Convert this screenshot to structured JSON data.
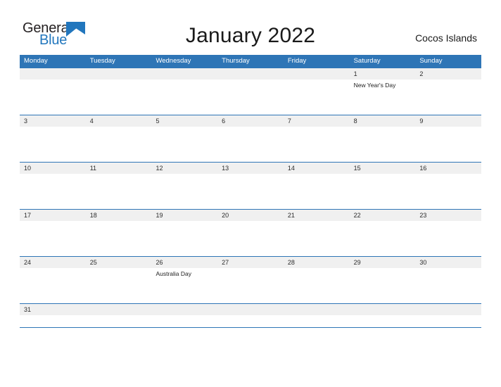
{
  "brand": {
    "name_part1": "General",
    "name_part2": "Blue",
    "flag_icon": "blue-flag-triangle",
    "accent_color": "#2176bd"
  },
  "header": {
    "title": "January 2022",
    "region": "Cocos Islands"
  },
  "theme": {
    "header_blue": "#2e75b6",
    "date_band_gray": "#f0f0f0",
    "text_dark": "#1a1a1a"
  },
  "calendar": {
    "weekdays": [
      "Monday",
      "Tuesday",
      "Wednesday",
      "Thursday",
      "Friday",
      "Saturday",
      "Sunday"
    ],
    "weeks": [
      {
        "days": [
          {
            "date": "",
            "event": ""
          },
          {
            "date": "",
            "event": ""
          },
          {
            "date": "",
            "event": ""
          },
          {
            "date": "",
            "event": ""
          },
          {
            "date": "",
            "event": ""
          },
          {
            "date": "1",
            "event": "New Year's Day"
          },
          {
            "date": "2",
            "event": ""
          }
        ]
      },
      {
        "days": [
          {
            "date": "3",
            "event": ""
          },
          {
            "date": "4",
            "event": ""
          },
          {
            "date": "5",
            "event": ""
          },
          {
            "date": "6",
            "event": ""
          },
          {
            "date": "7",
            "event": ""
          },
          {
            "date": "8",
            "event": ""
          },
          {
            "date": "9",
            "event": ""
          }
        ]
      },
      {
        "days": [
          {
            "date": "10",
            "event": ""
          },
          {
            "date": "11",
            "event": ""
          },
          {
            "date": "12",
            "event": ""
          },
          {
            "date": "13",
            "event": ""
          },
          {
            "date": "14",
            "event": ""
          },
          {
            "date": "15",
            "event": ""
          },
          {
            "date": "16",
            "event": ""
          }
        ]
      },
      {
        "days": [
          {
            "date": "17",
            "event": ""
          },
          {
            "date": "18",
            "event": ""
          },
          {
            "date": "19",
            "event": ""
          },
          {
            "date": "20",
            "event": ""
          },
          {
            "date": "21",
            "event": ""
          },
          {
            "date": "22",
            "event": ""
          },
          {
            "date": "23",
            "event": ""
          }
        ]
      },
      {
        "days": [
          {
            "date": "24",
            "event": ""
          },
          {
            "date": "25",
            "event": ""
          },
          {
            "date": "26",
            "event": "Australia Day"
          },
          {
            "date": "27",
            "event": ""
          },
          {
            "date": "28",
            "event": ""
          },
          {
            "date": "29",
            "event": ""
          },
          {
            "date": "30",
            "event": ""
          }
        ]
      },
      {
        "days": [
          {
            "date": "31",
            "event": ""
          },
          {
            "date": "",
            "event": ""
          },
          {
            "date": "",
            "event": ""
          },
          {
            "date": "",
            "event": ""
          },
          {
            "date": "",
            "event": ""
          },
          {
            "date": "",
            "event": ""
          },
          {
            "date": "",
            "event": ""
          }
        ]
      }
    ]
  }
}
